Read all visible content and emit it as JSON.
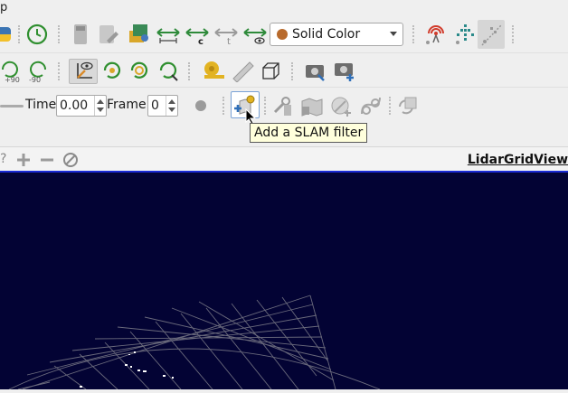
{
  "menubar": {
    "partial_label": "p"
  },
  "toolbar1": {
    "color_by": {
      "selected": "Solid Color",
      "swatch": "#b86a2c"
    }
  },
  "toolbar2": {
    "rotate_ccw_label": "+90",
    "rotate_cw_label": "-90"
  },
  "toolbar3": {
    "time_label": "Time",
    "time_value": "0.00",
    "frame_label": "Frame",
    "frame_value": "0"
  },
  "tooltip": {
    "text": "Add a SLAM filter"
  },
  "view": {
    "help_partial": "?",
    "title": "LidarGridView",
    "background": "#030334"
  }
}
